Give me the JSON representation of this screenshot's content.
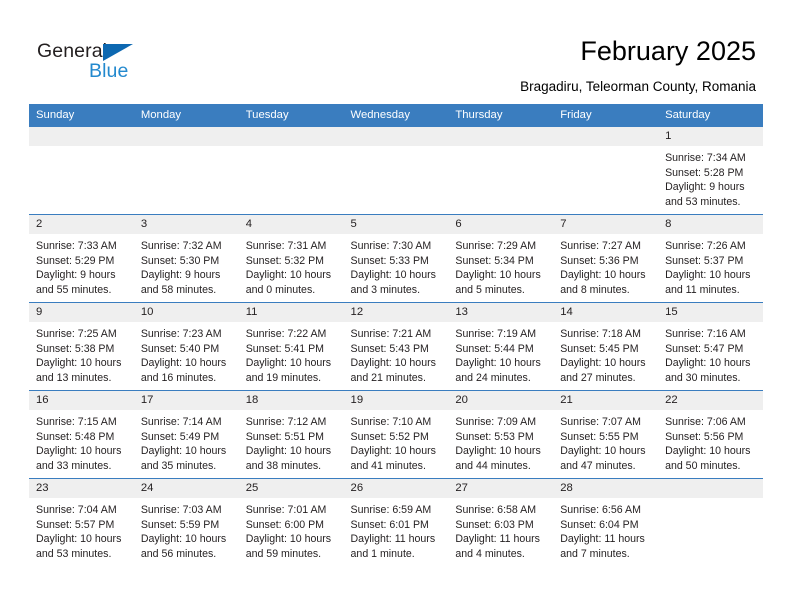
{
  "brand": {
    "name_part1": "General",
    "name_part2": "Blue",
    "accent_color": "#2389ce",
    "triangle_color": "#0d68b1"
  },
  "header": {
    "title": "February 2025",
    "subtitle": "Bragadiru, Teleorman County, Romania"
  },
  "calendar": {
    "header_background": "#3a7dbf",
    "weekday_headers": [
      "Sunday",
      "Monday",
      "Tuesday",
      "Wednesday",
      "Thursday",
      "Friday",
      "Saturday"
    ],
    "weeks": [
      [
        {
          "day": "",
          "sunrise": "",
          "sunset": "",
          "daylight": "",
          "blank": true
        },
        {
          "day": "",
          "sunrise": "",
          "sunset": "",
          "daylight": "",
          "blank": true
        },
        {
          "day": "",
          "sunrise": "",
          "sunset": "",
          "daylight": "",
          "blank": true
        },
        {
          "day": "",
          "sunrise": "",
          "sunset": "",
          "daylight": "",
          "blank": true
        },
        {
          "day": "",
          "sunrise": "",
          "sunset": "",
          "daylight": "",
          "blank": true
        },
        {
          "day": "",
          "sunrise": "",
          "sunset": "",
          "daylight": "",
          "blank": true
        },
        {
          "day": "1",
          "sunrise": "Sunrise: 7:34 AM",
          "sunset": "Sunset: 5:28 PM",
          "daylight": "Daylight: 9 hours and 53 minutes."
        }
      ],
      [
        {
          "day": "2",
          "sunrise": "Sunrise: 7:33 AM",
          "sunset": "Sunset: 5:29 PM",
          "daylight": "Daylight: 9 hours and 55 minutes."
        },
        {
          "day": "3",
          "sunrise": "Sunrise: 7:32 AM",
          "sunset": "Sunset: 5:30 PM",
          "daylight": "Daylight: 9 hours and 58 minutes."
        },
        {
          "day": "4",
          "sunrise": "Sunrise: 7:31 AM",
          "sunset": "Sunset: 5:32 PM",
          "daylight": "Daylight: 10 hours and 0 minutes."
        },
        {
          "day": "5",
          "sunrise": "Sunrise: 7:30 AM",
          "sunset": "Sunset: 5:33 PM",
          "daylight": "Daylight: 10 hours and 3 minutes."
        },
        {
          "day": "6",
          "sunrise": "Sunrise: 7:29 AM",
          "sunset": "Sunset: 5:34 PM",
          "daylight": "Daylight: 10 hours and 5 minutes."
        },
        {
          "day": "7",
          "sunrise": "Sunrise: 7:27 AM",
          "sunset": "Sunset: 5:36 PM",
          "daylight": "Daylight: 10 hours and 8 minutes."
        },
        {
          "day": "8",
          "sunrise": "Sunrise: 7:26 AM",
          "sunset": "Sunset: 5:37 PM",
          "daylight": "Daylight: 10 hours and 11 minutes."
        }
      ],
      [
        {
          "day": "9",
          "sunrise": "Sunrise: 7:25 AM",
          "sunset": "Sunset: 5:38 PM",
          "daylight": "Daylight: 10 hours and 13 minutes."
        },
        {
          "day": "10",
          "sunrise": "Sunrise: 7:23 AM",
          "sunset": "Sunset: 5:40 PM",
          "daylight": "Daylight: 10 hours and 16 minutes."
        },
        {
          "day": "11",
          "sunrise": "Sunrise: 7:22 AM",
          "sunset": "Sunset: 5:41 PM",
          "daylight": "Daylight: 10 hours and 19 minutes."
        },
        {
          "day": "12",
          "sunrise": "Sunrise: 7:21 AM",
          "sunset": "Sunset: 5:43 PM",
          "daylight": "Daylight: 10 hours and 21 minutes."
        },
        {
          "day": "13",
          "sunrise": "Sunrise: 7:19 AM",
          "sunset": "Sunset: 5:44 PM",
          "daylight": "Daylight: 10 hours and 24 minutes."
        },
        {
          "day": "14",
          "sunrise": "Sunrise: 7:18 AM",
          "sunset": "Sunset: 5:45 PM",
          "daylight": "Daylight: 10 hours and 27 minutes."
        },
        {
          "day": "15",
          "sunrise": "Sunrise: 7:16 AM",
          "sunset": "Sunset: 5:47 PM",
          "daylight": "Daylight: 10 hours and 30 minutes."
        }
      ],
      [
        {
          "day": "16",
          "sunrise": "Sunrise: 7:15 AM",
          "sunset": "Sunset: 5:48 PM",
          "daylight": "Daylight: 10 hours and 33 minutes."
        },
        {
          "day": "17",
          "sunrise": "Sunrise: 7:14 AM",
          "sunset": "Sunset: 5:49 PM",
          "daylight": "Daylight: 10 hours and 35 minutes."
        },
        {
          "day": "18",
          "sunrise": "Sunrise: 7:12 AM",
          "sunset": "Sunset: 5:51 PM",
          "daylight": "Daylight: 10 hours and 38 minutes."
        },
        {
          "day": "19",
          "sunrise": "Sunrise: 7:10 AM",
          "sunset": "Sunset: 5:52 PM",
          "daylight": "Daylight: 10 hours and 41 minutes."
        },
        {
          "day": "20",
          "sunrise": "Sunrise: 7:09 AM",
          "sunset": "Sunset: 5:53 PM",
          "daylight": "Daylight: 10 hours and 44 minutes."
        },
        {
          "day": "21",
          "sunrise": "Sunrise: 7:07 AM",
          "sunset": "Sunset: 5:55 PM",
          "daylight": "Daylight: 10 hours and 47 minutes."
        },
        {
          "day": "22",
          "sunrise": "Sunrise: 7:06 AM",
          "sunset": "Sunset: 5:56 PM",
          "daylight": "Daylight: 10 hours and 50 minutes."
        }
      ],
      [
        {
          "day": "23",
          "sunrise": "Sunrise: 7:04 AM",
          "sunset": "Sunset: 5:57 PM",
          "daylight": "Daylight: 10 hours and 53 minutes."
        },
        {
          "day": "24",
          "sunrise": "Sunrise: 7:03 AM",
          "sunset": "Sunset: 5:59 PM",
          "daylight": "Daylight: 10 hours and 56 minutes."
        },
        {
          "day": "25",
          "sunrise": "Sunrise: 7:01 AM",
          "sunset": "Sunset: 6:00 PM",
          "daylight": "Daylight: 10 hours and 59 minutes."
        },
        {
          "day": "26",
          "sunrise": "Sunrise: 6:59 AM",
          "sunset": "Sunset: 6:01 PM",
          "daylight": "Daylight: 11 hours and 1 minute."
        },
        {
          "day": "27",
          "sunrise": "Sunrise: 6:58 AM",
          "sunset": "Sunset: 6:03 PM",
          "daylight": "Daylight: 11 hours and 4 minutes."
        },
        {
          "day": "28",
          "sunrise": "Sunrise: 6:56 AM",
          "sunset": "Sunset: 6:04 PM",
          "daylight": "Daylight: 11 hours and 7 minutes."
        },
        {
          "day": "",
          "sunrise": "",
          "sunset": "",
          "daylight": "",
          "blank": true
        }
      ]
    ]
  }
}
